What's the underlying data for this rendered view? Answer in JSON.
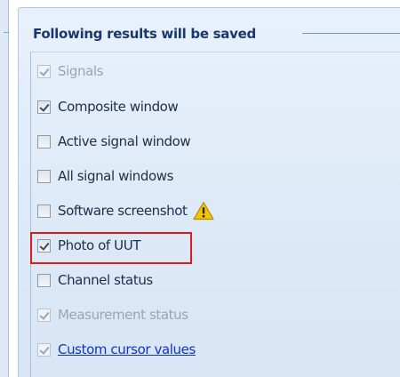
{
  "group": {
    "title": "Following results will be saved"
  },
  "options": [
    {
      "label": "Signals",
      "checked": true,
      "enabled": false
    },
    {
      "label": "Composite window",
      "checked": true,
      "enabled": true
    },
    {
      "label": "Active signal window",
      "checked": false,
      "enabled": true
    },
    {
      "label": "All signal windows",
      "checked": false,
      "enabled": true
    },
    {
      "label": "Software screenshot",
      "checked": false,
      "enabled": true,
      "icon": "warning-icon"
    },
    {
      "label": "Photo of UUT",
      "checked": true,
      "enabled": true,
      "highlighted": true
    },
    {
      "label": "Channel status",
      "checked": false,
      "enabled": true
    },
    {
      "label": "Measurement status",
      "checked": true,
      "enabled": false
    },
    {
      "label": "Custom cursor values",
      "checked": true,
      "enabled": false,
      "link": true
    }
  ],
  "colors": {
    "panel_bg": "#dde9f7",
    "title": "#18386e",
    "highlight": "#e0191b",
    "link": "#1133cc",
    "warning": "#f6c400"
  }
}
